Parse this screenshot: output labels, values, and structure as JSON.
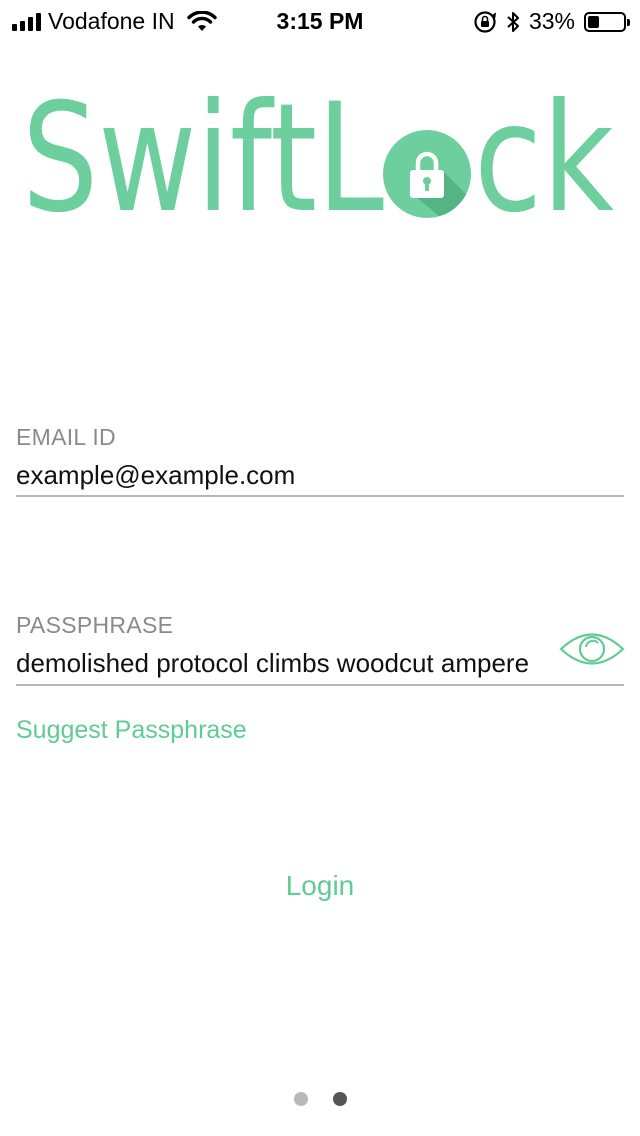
{
  "status_bar": {
    "carrier": "Vodafone IN",
    "time": "3:15 PM",
    "battery_percent": "33%",
    "battery_level": 0.33,
    "icons": [
      "signal-icon",
      "wifi-icon",
      "rotation-lock-icon",
      "bluetooth-icon",
      "battery-icon"
    ]
  },
  "logo": {
    "text_part1": "SwiftL",
    "text_part2": "ck",
    "icon": "padlock-icon"
  },
  "email": {
    "label": "EMAIL ID",
    "value": "example@example.com"
  },
  "passphrase": {
    "label": "PASSPHRASE",
    "value": "demolished protocol climbs woodcut ampere",
    "toggle_icon": "eye-icon"
  },
  "suggest_link": "Suggest Passphrase",
  "login_button": "Login",
  "pager": {
    "page_count": 2,
    "active_index": 1
  },
  "colors": {
    "accent": "#5fcb95",
    "logo_green": "#6ecf9e",
    "label_gray": "#8a8a8a",
    "divider": "#b5b5b5",
    "dot_inactive": "#b9b9b9",
    "dot_active": "#555555"
  }
}
